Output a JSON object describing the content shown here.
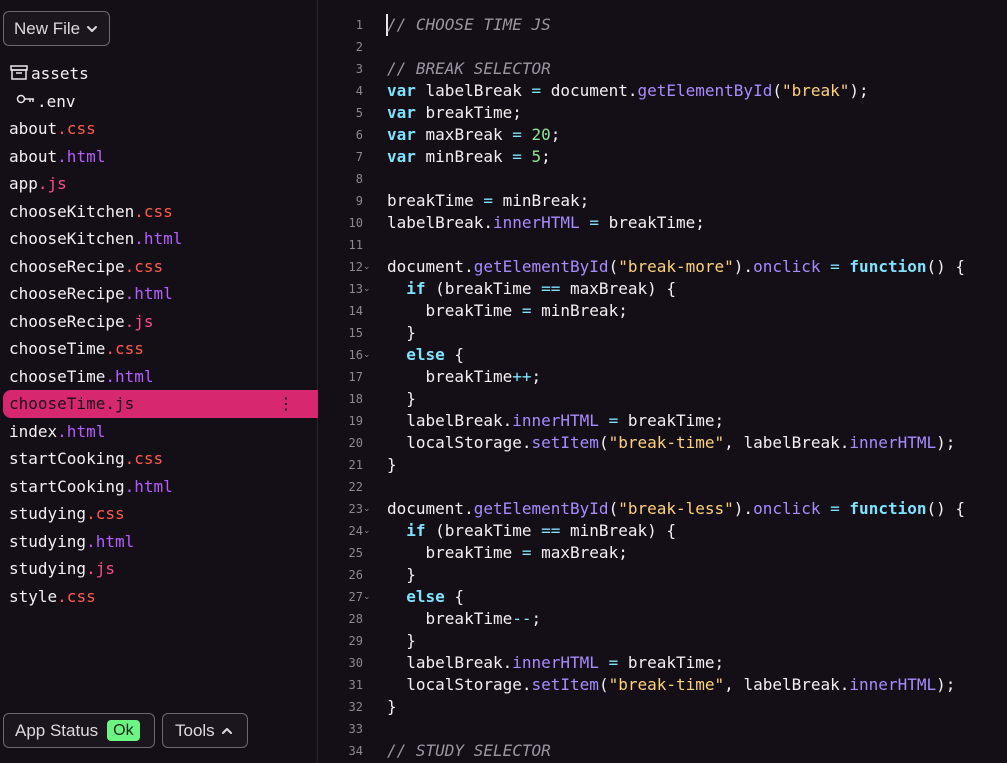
{
  "sidebar": {
    "new_file_label": "New File",
    "files": [
      {
        "icon": "folder-archive-icon",
        "name": "assets",
        "ext": ""
      },
      {
        "icon": "key-icon",
        "name": ".env",
        "ext": ""
      },
      {
        "name": "about",
        "ext": ".css",
        "ext_kind": "css"
      },
      {
        "name": "about",
        "ext": ".html",
        "ext_kind": "html"
      },
      {
        "name": "app",
        "ext": ".js",
        "ext_kind": "js"
      },
      {
        "name": "chooseKitchen",
        "ext": ".css",
        "ext_kind": "css"
      },
      {
        "name": "chooseKitchen",
        "ext": ".html",
        "ext_kind": "html"
      },
      {
        "name": "chooseRecipe",
        "ext": ".css",
        "ext_kind": "css"
      },
      {
        "name": "chooseRecipe",
        "ext": ".html",
        "ext_kind": "html"
      },
      {
        "name": "chooseRecipe",
        "ext": ".js",
        "ext_kind": "js"
      },
      {
        "name": "chooseTime",
        "ext": ".css",
        "ext_kind": "css"
      },
      {
        "name": "chooseTime",
        "ext": ".html",
        "ext_kind": "html"
      },
      {
        "name": "chooseTime",
        "ext": ".js",
        "ext_kind": "js",
        "selected": true
      },
      {
        "name": "index",
        "ext": ".html",
        "ext_kind": "html"
      },
      {
        "name": "startCooking",
        "ext": ".css",
        "ext_kind": "css"
      },
      {
        "name": "startCooking",
        "ext": ".html",
        "ext_kind": "html"
      },
      {
        "name": "studying",
        "ext": ".css",
        "ext_kind": "css"
      },
      {
        "name": "studying",
        "ext": ".html",
        "ext_kind": "html"
      },
      {
        "name": "studying",
        "ext": ".js",
        "ext_kind": "js"
      },
      {
        "name": "style",
        "ext": ".css",
        "ext_kind": "css"
      }
    ],
    "selected_menu_icon": "⋮",
    "app_status_label": "App Status",
    "app_status_value": "Ok",
    "tools_label": "Tools"
  },
  "editor": {
    "lines": [
      {
        "n": "1",
        "fold": false,
        "tokens": [
          [
            "comment",
            "// CHOOSE TIME JS"
          ]
        ]
      },
      {
        "n": "2",
        "fold": false,
        "tokens": []
      },
      {
        "n": "3",
        "fold": false,
        "tokens": [
          [
            "comment",
            "// BREAK SELECTOR"
          ]
        ]
      },
      {
        "n": "4",
        "fold": false,
        "tokens": [
          [
            "keyword",
            "var"
          ],
          [
            "plain",
            " labelBreak "
          ],
          [
            "op",
            "="
          ],
          [
            "plain",
            " document."
          ],
          [
            "prop",
            "getElementById"
          ],
          [
            "plain",
            "("
          ],
          [
            "string",
            "\"break\""
          ],
          [
            "plain",
            ");"
          ]
        ]
      },
      {
        "n": "5",
        "fold": false,
        "tokens": [
          [
            "keyword",
            "var"
          ],
          [
            "plain",
            " breakTime;"
          ]
        ]
      },
      {
        "n": "6",
        "fold": false,
        "tokens": [
          [
            "keyword",
            "var"
          ],
          [
            "plain",
            " maxBreak "
          ],
          [
            "op",
            "="
          ],
          [
            "plain",
            " "
          ],
          [
            "number",
            "20"
          ],
          [
            "plain",
            ";"
          ]
        ]
      },
      {
        "n": "7",
        "fold": false,
        "tokens": [
          [
            "keyword",
            "var"
          ],
          [
            "plain",
            " minBreak "
          ],
          [
            "op",
            "="
          ],
          [
            "plain",
            " "
          ],
          [
            "number",
            "5"
          ],
          [
            "plain",
            ";"
          ]
        ]
      },
      {
        "n": "8",
        "fold": false,
        "tokens": []
      },
      {
        "n": "9",
        "fold": false,
        "tokens": [
          [
            "plain",
            "breakTime "
          ],
          [
            "op",
            "="
          ],
          [
            "plain",
            " minBreak;"
          ]
        ]
      },
      {
        "n": "10",
        "fold": false,
        "tokens": [
          [
            "plain",
            "labelBreak."
          ],
          [
            "prop",
            "innerHTML"
          ],
          [
            "plain",
            " "
          ],
          [
            "op",
            "="
          ],
          [
            "plain",
            " breakTime;"
          ]
        ]
      },
      {
        "n": "11",
        "fold": false,
        "tokens": []
      },
      {
        "n": "12",
        "fold": true,
        "tokens": [
          [
            "plain",
            "document."
          ],
          [
            "prop",
            "getElementById"
          ],
          [
            "plain",
            "("
          ],
          [
            "string",
            "\"break-more\""
          ],
          [
            "plain",
            ")."
          ],
          [
            "prop",
            "onclick"
          ],
          [
            "plain",
            " "
          ],
          [
            "op",
            "="
          ],
          [
            "plain",
            " "
          ],
          [
            "keyword",
            "function"
          ],
          [
            "plain",
            "() {"
          ]
        ]
      },
      {
        "n": "13",
        "fold": true,
        "tokens": [
          [
            "plain",
            "  "
          ],
          [
            "keyword",
            "if"
          ],
          [
            "plain",
            " (breakTime "
          ],
          [
            "op",
            "=="
          ],
          [
            "plain",
            " maxBreak) {"
          ]
        ]
      },
      {
        "n": "14",
        "fold": false,
        "tokens": [
          [
            "plain",
            "    breakTime "
          ],
          [
            "op",
            "="
          ],
          [
            "plain",
            " minBreak;"
          ]
        ]
      },
      {
        "n": "15",
        "fold": false,
        "tokens": [
          [
            "plain",
            "  }"
          ]
        ]
      },
      {
        "n": "16",
        "fold": true,
        "tokens": [
          [
            "plain",
            "  "
          ],
          [
            "keyword",
            "else"
          ],
          [
            "plain",
            " {"
          ]
        ]
      },
      {
        "n": "17",
        "fold": false,
        "tokens": [
          [
            "plain",
            "    breakTime"
          ],
          [
            "op",
            "++"
          ],
          [
            "plain",
            ";"
          ]
        ]
      },
      {
        "n": "18",
        "fold": false,
        "tokens": [
          [
            "plain",
            "  }"
          ]
        ]
      },
      {
        "n": "19",
        "fold": false,
        "tokens": [
          [
            "plain",
            "  labelBreak."
          ],
          [
            "prop",
            "innerHTML"
          ],
          [
            "plain",
            " "
          ],
          [
            "op",
            "="
          ],
          [
            "plain",
            " breakTime;"
          ]
        ]
      },
      {
        "n": "20",
        "fold": false,
        "tokens": [
          [
            "plain",
            "  localStorage."
          ],
          [
            "prop",
            "setItem"
          ],
          [
            "plain",
            "("
          ],
          [
            "string",
            "\"break-time\""
          ],
          [
            "plain",
            ", labelBreak."
          ],
          [
            "prop",
            "innerHTML"
          ],
          [
            "plain",
            ");"
          ]
        ]
      },
      {
        "n": "21",
        "fold": false,
        "tokens": [
          [
            "plain",
            "}"
          ]
        ]
      },
      {
        "n": "22",
        "fold": false,
        "tokens": []
      },
      {
        "n": "23",
        "fold": true,
        "tokens": [
          [
            "plain",
            "document."
          ],
          [
            "prop",
            "getElementById"
          ],
          [
            "plain",
            "("
          ],
          [
            "string",
            "\"break-less\""
          ],
          [
            "plain",
            ")."
          ],
          [
            "prop",
            "onclick"
          ],
          [
            "plain",
            " "
          ],
          [
            "op",
            "="
          ],
          [
            "plain",
            " "
          ],
          [
            "keyword",
            "function"
          ],
          [
            "plain",
            "() {"
          ]
        ]
      },
      {
        "n": "24",
        "fold": true,
        "tokens": [
          [
            "plain",
            "  "
          ],
          [
            "keyword",
            "if"
          ],
          [
            "plain",
            " (breakTime "
          ],
          [
            "op",
            "=="
          ],
          [
            "plain",
            " minBreak) {"
          ]
        ]
      },
      {
        "n": "25",
        "fold": false,
        "tokens": [
          [
            "plain",
            "    breakTime "
          ],
          [
            "op",
            "="
          ],
          [
            "plain",
            " maxBreak;"
          ]
        ]
      },
      {
        "n": "26",
        "fold": false,
        "tokens": [
          [
            "plain",
            "  }"
          ]
        ]
      },
      {
        "n": "27",
        "fold": true,
        "tokens": [
          [
            "plain",
            "  "
          ],
          [
            "keyword",
            "else"
          ],
          [
            "plain",
            " {"
          ]
        ]
      },
      {
        "n": "28",
        "fold": false,
        "tokens": [
          [
            "plain",
            "    breakTime"
          ],
          [
            "op",
            "--"
          ],
          [
            "plain",
            ";"
          ]
        ]
      },
      {
        "n": "29",
        "fold": false,
        "tokens": [
          [
            "plain",
            "  }"
          ]
        ]
      },
      {
        "n": "30",
        "fold": false,
        "tokens": [
          [
            "plain",
            "  labelBreak."
          ],
          [
            "prop",
            "innerHTML"
          ],
          [
            "plain",
            " "
          ],
          [
            "op",
            "="
          ],
          [
            "plain",
            " breakTime;"
          ]
        ]
      },
      {
        "n": "31",
        "fold": false,
        "tokens": [
          [
            "plain",
            "  localStorage."
          ],
          [
            "prop",
            "setItem"
          ],
          [
            "plain",
            "("
          ],
          [
            "string",
            "\"break-time\""
          ],
          [
            "plain",
            ", labelBreak."
          ],
          [
            "prop",
            "innerHTML"
          ],
          [
            "plain",
            ");"
          ]
        ]
      },
      {
        "n": "32",
        "fold": false,
        "tokens": [
          [
            "plain",
            "}"
          ]
        ]
      },
      {
        "n": "33",
        "fold": false,
        "tokens": []
      },
      {
        "n": "34",
        "fold": false,
        "tokens": [
          [
            "comment",
            "// STUDY SELECTOR"
          ]
        ]
      }
    ]
  },
  "colors": {
    "background": "#140f16",
    "selected_item": "#d7286f",
    "status_ok": "#6cf582",
    "ext_css": "#ff5a4f",
    "ext_html": "#b55cff",
    "ext_js": "#ff4a8a",
    "keyword": "#7ee3ff",
    "string": "#ffd27a",
    "number": "#8ee79a",
    "property": "#a98bff",
    "comment": "#9a96a0"
  }
}
